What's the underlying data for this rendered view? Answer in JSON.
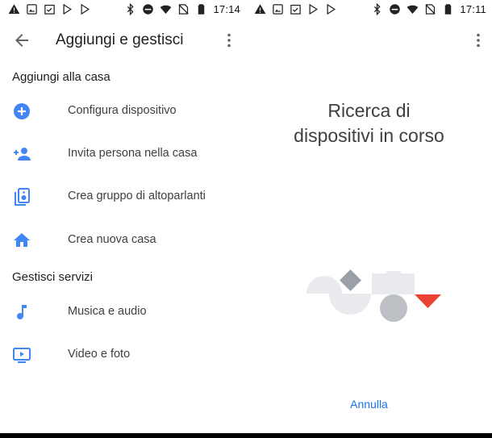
{
  "status_left": {
    "time": "17:14"
  },
  "status_right": {
    "time": "17:11"
  },
  "left_screen": {
    "title": "Aggiungi e gestisci",
    "sections": [
      {
        "header": "Aggiungi alla casa",
        "items": [
          {
            "label": "Configura dispositivo",
            "icon": "add-circle-icon"
          },
          {
            "label": "Invita persona nella casa",
            "icon": "person-add-icon"
          },
          {
            "label": "Crea gruppo di altoparlanti",
            "icon": "speaker-group-icon"
          },
          {
            "label": "Crea nuova casa",
            "icon": "home-icon"
          }
        ]
      },
      {
        "header": "Gestisci servizi",
        "items": [
          {
            "label": "Musica e audio",
            "icon": "music-note-icon"
          },
          {
            "label": "Video e foto",
            "icon": "tv-play-icon"
          }
        ]
      }
    ]
  },
  "right_screen": {
    "heading_line1": "Ricerca di",
    "heading_line2": "dispositivi in corso",
    "cancel_label": "Annulla"
  },
  "colors": {
    "accent": "#1a73e8",
    "icon_blue": "#4285f4",
    "red": "#ea4335",
    "gray_light": "#e8eaed",
    "gray_mid": "#bdc1c6",
    "gray_dark": "#9aa0a6"
  }
}
